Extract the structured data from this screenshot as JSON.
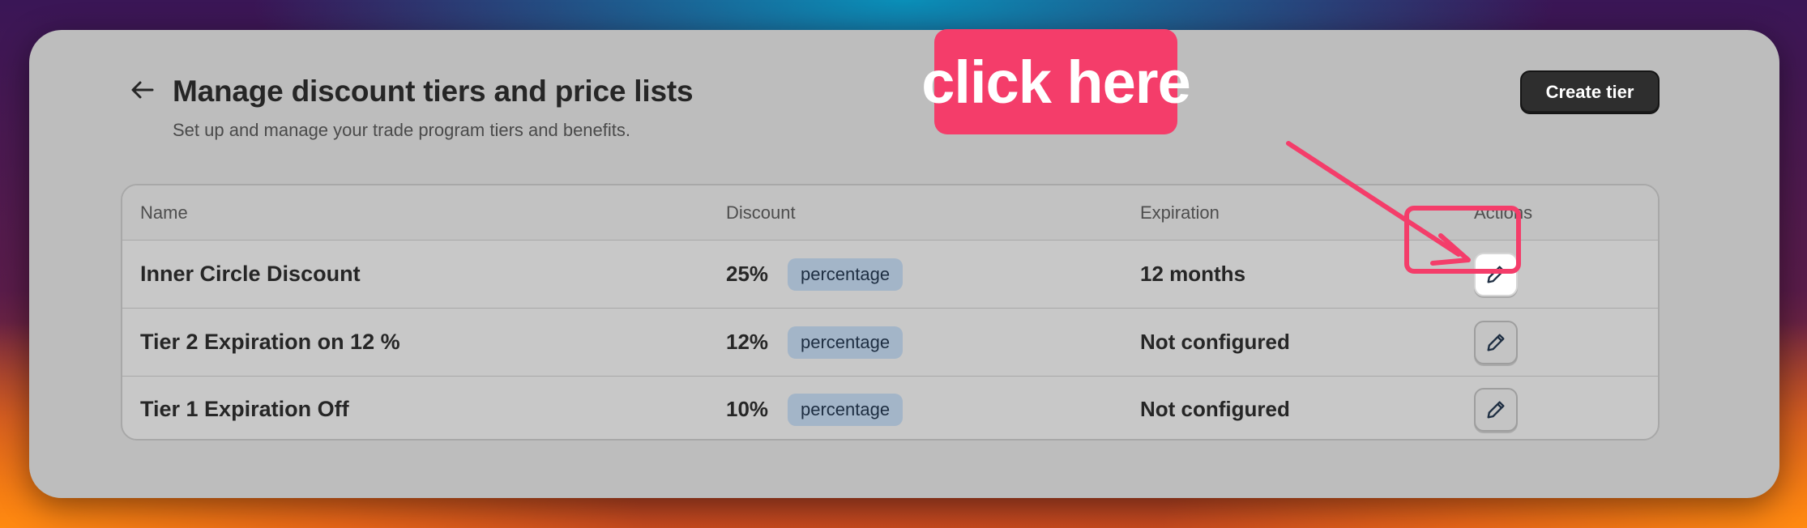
{
  "header": {
    "back_icon": "arrow-left-icon",
    "title": "Manage discount tiers and price lists",
    "subtitle": "Set up and manage your trade program tiers and benefits.",
    "create_button": "Create tier"
  },
  "table": {
    "columns": [
      "Name",
      "Discount",
      "Expiration",
      "Actions"
    ],
    "rows": [
      {
        "name": "Inner Circle Discount",
        "discount": "25%",
        "type": "percentage",
        "expiration": "12 months",
        "action_icon": "pencil-icon"
      },
      {
        "name": "Tier 2 Expiration on 12 %",
        "discount": "12%",
        "type": "percentage",
        "expiration": "Not configured",
        "action_icon": "pencil-icon"
      },
      {
        "name": "Tier 1 Expiration Off",
        "discount": "10%",
        "type": "percentage",
        "expiration": "Not configured",
        "action_icon": "pencil-icon"
      }
    ]
  },
  "annotation": {
    "callout_text": "click here",
    "color": "#f43d6a"
  },
  "colors": {
    "badge_bg": "#a3b5c8",
    "badge_text": "#1e2e42",
    "primary_button": "#2e2e2e"
  }
}
